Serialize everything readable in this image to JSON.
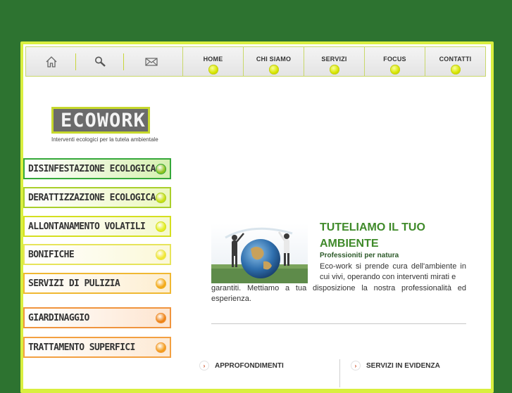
{
  "nav": {
    "icons": [
      "home-icon",
      "search-icon",
      "mail-icon"
    ],
    "items": [
      {
        "label": "HOME"
      },
      {
        "label": "CHI SIAMO"
      },
      {
        "label": "SERVIZI"
      },
      {
        "label": "FOCUS"
      },
      {
        "label": "CONTATTI"
      }
    ]
  },
  "logo": {
    "name": "ECOWORK",
    "tagline": "Interventi ecologici per la tutela ambientale"
  },
  "menu": [
    {
      "label": "DISINFESTAZIONE ECOLOGICA",
      "border": "#35a83a",
      "bg": "#d6f0b0",
      "dot": "#8fc21e"
    },
    {
      "label": "DERATTIZZAZIONE ECOLOGICA",
      "border": "#a9cf2a",
      "bg": "#ecf8bf",
      "dot": "#c9e014"
    },
    {
      "label": "ALLONTANAMENTO VOLATILI",
      "border": "#d5df1f",
      "bg": "#f5f9cf",
      "dot": "#e3ee25"
    },
    {
      "label": "BONIFICHE",
      "border": "#e7e45a",
      "bg": "#fbf8d8",
      "dot": "#f1e631"
    },
    {
      "label": "SERVIZI DI PULIZIA",
      "border": "#f0b832",
      "bg": "#fdeed0",
      "dot": "#f3a818"
    },
    {
      "label": "GIARDINAGGIO",
      "border": "#f0943d",
      "bg": "#fde5d0",
      "dot": "#ee8314"
    },
    {
      "label": "TRATTAMENTO SUPERFICI",
      "border": "#f3a041",
      "bg": "#fde9d4",
      "dot": "#f39c1b"
    }
  ],
  "main": {
    "title": "TUTELIAMO IL TUO AMBIENTE",
    "subtitle": "Professioniti per natura",
    "body_a": "Eco-work si prende cura dell'ambiente in cui vivi, operando con interventi mirati e",
    "body_b": "garantiti. Mettiamo a tua disposizione la nostra professionalità ed esperienza."
  },
  "sections": {
    "left": "APPROFONDIMENTI",
    "right": "SERVIZI IN EVIDENZA"
  },
  "colors": {
    "background": "#2d7330",
    "frame": "#d9ef3f",
    "title": "#3f8a2a"
  }
}
